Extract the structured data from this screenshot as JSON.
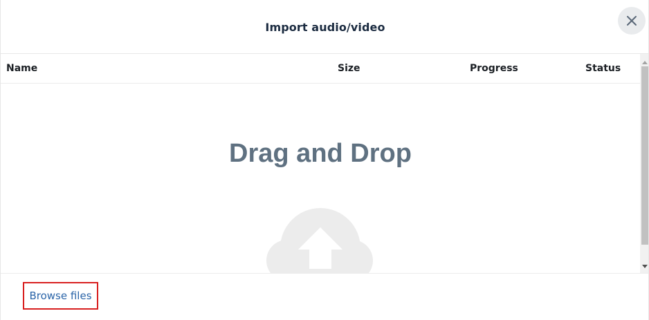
{
  "dialog": {
    "title": "Import audio/video",
    "close_icon": "close-icon"
  },
  "table": {
    "columns": [
      "Name",
      "Size",
      "Progress",
      "Status"
    ]
  },
  "drop_zone": {
    "text": "Drag and Drop",
    "icon": "cloud-upload-icon"
  },
  "footer": {
    "browse_label": "Browse files"
  },
  "colors": {
    "title": "#1b2b40",
    "drop_text": "#5f7181",
    "link": "#2a64a8",
    "highlight_border": "#d81e1e",
    "icon_fill": "#ececec"
  }
}
